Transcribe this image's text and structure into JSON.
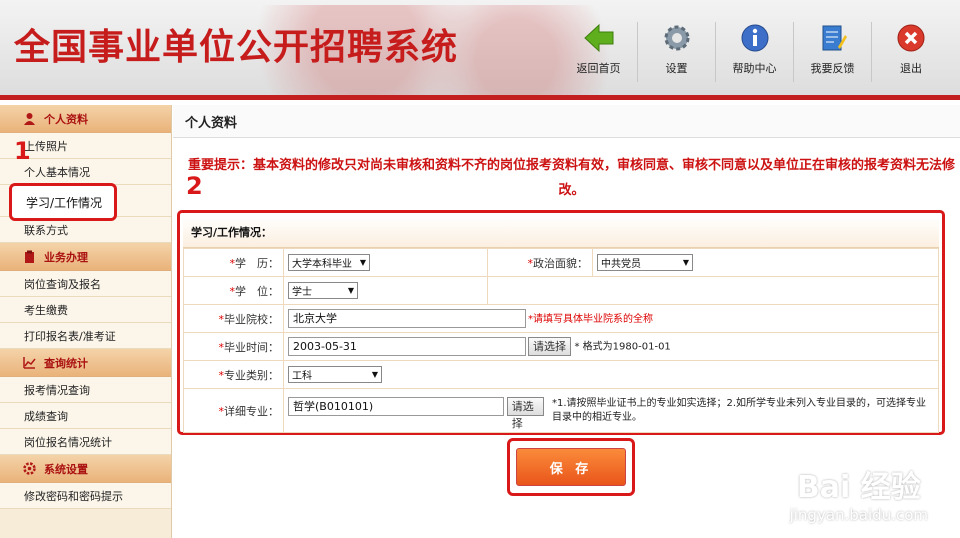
{
  "header": {
    "title": "全国事业单位公开招聘系统",
    "tools": [
      {
        "label": "返回首页",
        "icon": "back-arrow-icon"
      },
      {
        "label": "设置",
        "icon": "gear-icon"
      },
      {
        "label": "帮助中心",
        "icon": "info-icon"
      },
      {
        "label": "我要反馈",
        "icon": "feedback-icon"
      },
      {
        "label": "退出",
        "icon": "close-icon"
      }
    ]
  },
  "sidebar": {
    "sections": [
      {
        "title": "个人资料",
        "icon": "person-icon",
        "items": [
          "上传照片",
          "个人基本情况",
          "学习/工作情况",
          "联系方式"
        ]
      },
      {
        "title": "业务办理",
        "icon": "clipboard-icon",
        "items": [
          "岗位查询及报名",
          "考生缴费",
          "打印报名表/准考证"
        ]
      },
      {
        "title": "查询统计",
        "icon": "chart-icon",
        "items": [
          "报考情况查询",
          "成绩查询",
          "岗位报名情况统计"
        ]
      },
      {
        "title": "系统设置",
        "icon": "settings-icon",
        "items": [
          "修改密码和密码提示"
        ]
      }
    ]
  },
  "annotations": {
    "one": "1",
    "two": "2"
  },
  "content": {
    "page_title": "个人资料",
    "notice_label": "重要提示：",
    "notice_text": "基本资料的修改只对尚未审核和资料不齐的岗位报考资料有效，审核同意、审核不同意以及单位正在审核的报考资料无法修改。",
    "form": {
      "heading": "学习/工作情况：",
      "education_label": "学　历：",
      "education_value": "大学本科毕业",
      "political_label": "政治面貌：",
      "political_value": "中共党员",
      "degree_label": "学　位：",
      "degree_value": "学士",
      "school_label": "毕业院校：",
      "school_value": "北京大学",
      "school_hint": "*请填写具体毕业院系的全称",
      "grad_time_label": "毕业时间：",
      "grad_time_value": "2003-05-31",
      "choose_button": "请选择",
      "grad_time_hint": "* 格式为1980-01-01",
      "category_label": "专业类别：",
      "category_value": "工科",
      "major_label": "详细专业：",
      "major_value": "哲学(B010101)",
      "major_hint": "*1.请按照毕业证书上的专业如实选择；2.如所学专业未列入专业目录的，可选择专业目录中的相近专业。"
    },
    "save_button": "保 存"
  },
  "watermark": {
    "line1": "Bai 经验",
    "line2": "jingyan.baidu.com"
  }
}
